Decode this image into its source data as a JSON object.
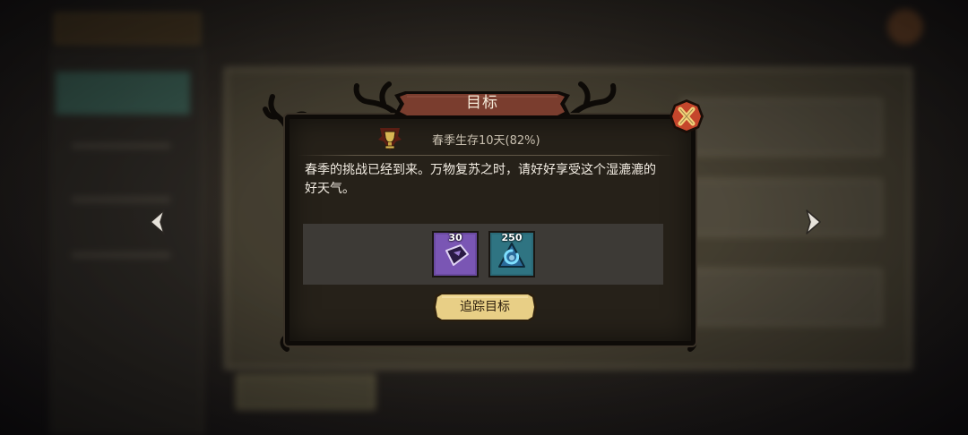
{
  "dialog": {
    "title": "目标",
    "goal": {
      "icon": "trophy-icon",
      "text": "春季生存10天(82%)",
      "progress_percent": 82
    },
    "description": "春季的挑战已经到来。万物复苏之时，请好好享受这个湿漉漉的好天气。",
    "rewards": [
      {
        "icon": "purple-gem-reward-icon",
        "count": "30"
      },
      {
        "icon": "blue-crystal-reward-icon",
        "count": "250"
      }
    ],
    "track_button": "追踪目标",
    "close_icon": "close-icon"
  },
  "navigation": {
    "prev_icon": "chevron-left-icon",
    "next_icon": "chevron-right-icon"
  },
  "colors": {
    "banner": "#7a3d2e",
    "close_badge": "#c5462c",
    "button": "#e8cf86",
    "reward_purple": "#6a4aa0",
    "reward_teal": "#2a6a78"
  }
}
